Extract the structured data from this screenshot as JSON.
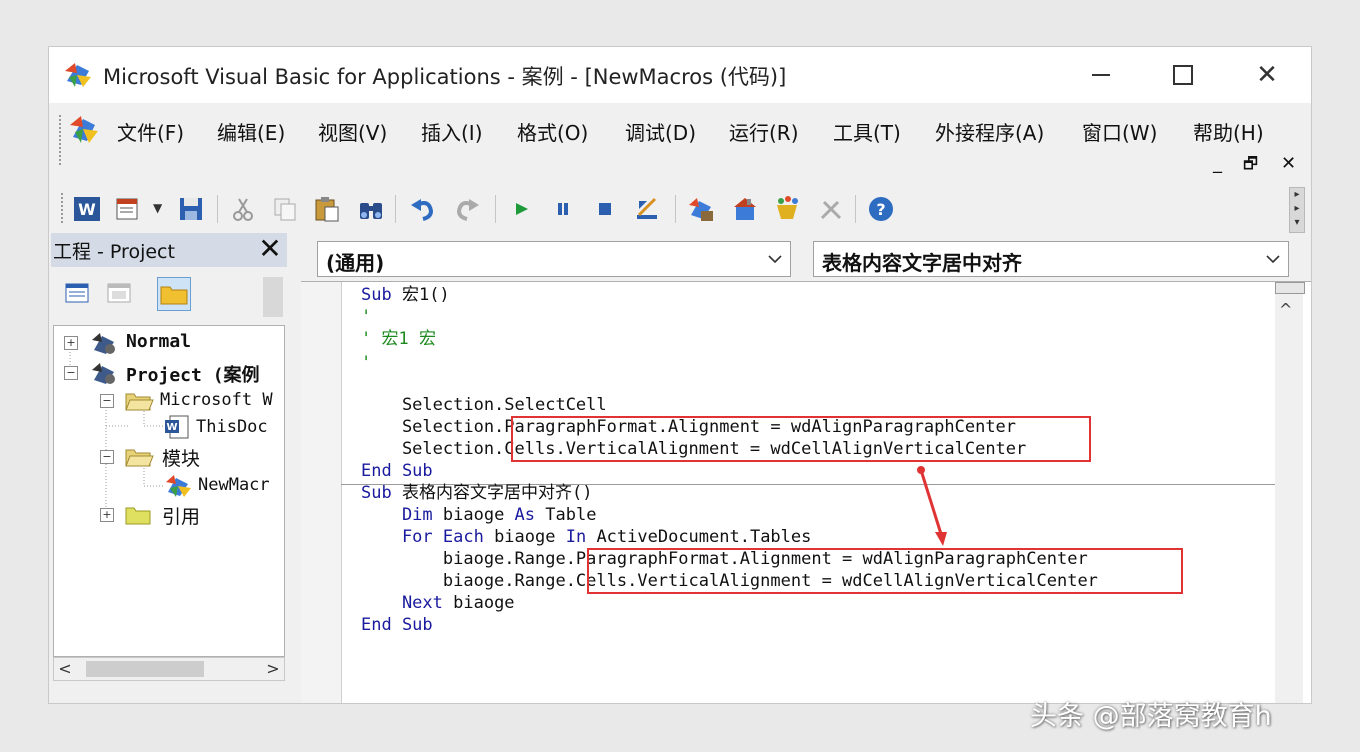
{
  "window": {
    "title": "Microsoft Visual Basic for Applications - 案例 - [NewMacros (代码)]",
    "controls": {
      "minimize": "minimize-icon",
      "maximize": "maximize-icon",
      "close": "close-icon"
    }
  },
  "menu": {
    "items": [
      {
        "label": "文件(F)"
      },
      {
        "label": "编辑(E)"
      },
      {
        "label": "视图(V)"
      },
      {
        "label": "插入(I)"
      },
      {
        "label": "格式(O)"
      },
      {
        "label": "调试(D)"
      },
      {
        "label": "运行(R)"
      },
      {
        "label": "工具(T)"
      },
      {
        "label": "外接程序(A)"
      },
      {
        "label": "窗口(W)"
      },
      {
        "label": "帮助(H)"
      }
    ],
    "mdi_close": "✕",
    "mdi_restore": "🗗",
    "mdi_minimize": "_"
  },
  "toolbar": {
    "icons": [
      "word-icon",
      "insert-module-icon",
      "save-icon",
      "cut-icon",
      "copy-icon",
      "paste-icon",
      "find-icon",
      "undo-icon",
      "redo-icon",
      "run-icon",
      "break-icon",
      "reset-icon",
      "design-mode-icon",
      "project-explorer-icon",
      "properties-icon",
      "object-browser-icon",
      "toolbox-icon",
      "help-icon"
    ]
  },
  "project": {
    "title": "工程 - Project",
    "tree": [
      {
        "label": "Normal",
        "expander": "+"
      },
      {
        "label": "Project (案例",
        "expander": "−"
      },
      {
        "label": "Microsoft W",
        "expander": "−"
      },
      {
        "label": "ThisDoc"
      },
      {
        "label": "模块",
        "expander": "−"
      },
      {
        "label": "NewMacr"
      },
      {
        "label": "引用",
        "expander": "+"
      }
    ],
    "scroll_left": "<",
    "scroll_right": ">"
  },
  "code": {
    "object_combo": "(通用)",
    "procedure_combo": "表格内容文字居中对齐",
    "lines": [
      {
        "kw": "Sub",
        "rest": " 宏1()"
      },
      {
        "cm": "'"
      },
      {
        "cm": "' 宏1 宏"
      },
      {
        "cm": "'"
      },
      {
        "text": "    Selection.SelectCell"
      },
      {
        "text": "    Selection.ParagraphFormat.Alignment = wdAlignParagraphCenter"
      },
      {
        "text": "    Selection.Cells.VerticalAlignment = wdCellAlignVerticalCenter"
      },
      {
        "kw": "End Sub",
        "rest": ""
      },
      {
        "kw": "Sub",
        "rest": " 表格内容文字居中对齐()"
      },
      {
        "kw": "    Dim",
        "rest": " biaoge ",
        "kw2": "As",
        "rest2": " Table"
      },
      {
        "kw": "    For Each",
        "rest": " biaoge ",
        "kw2": "In",
        "rest2": " ActiveDocument.Tables"
      },
      {
        "text": "        biaoge.Range.ParagraphFormat.Alignment = wdAlignParagraphCenter"
      },
      {
        "text": "        biaoge.Range.Cells.VerticalAlignment = wdCellAlignVerticalCenter"
      },
      {
        "kw": "    Next",
        "rest": " biaoge"
      },
      {
        "kw": "End Sub",
        "rest": ""
      }
    ]
  },
  "watermark": "头条 @部落窝教育h",
  "colors": {
    "keyword": "#1a1a9e",
    "comment": "#1e8a1e",
    "highlight": "#e03434"
  }
}
